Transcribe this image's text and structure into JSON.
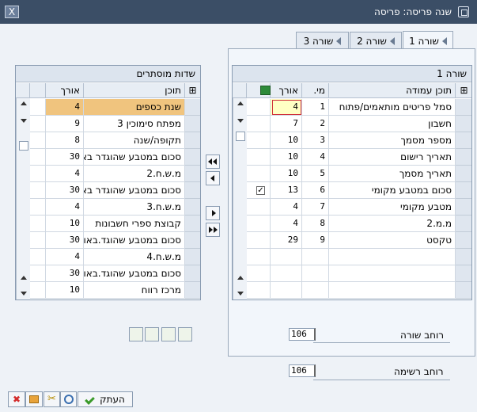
{
  "window": {
    "title": "שנה פריסה: פריסה",
    "close": "X"
  },
  "tabs": [
    {
      "label": "שורה 1",
      "active": true
    },
    {
      "label": "שורה 2",
      "active": false
    },
    {
      "label": "שורה 3",
      "active": false
    }
  ],
  "left_grid": {
    "title": "שדות מוסתרים",
    "headers": {
      "content": "תוכן",
      "length": "אורך"
    },
    "rows": [
      {
        "content": "שנת כספים",
        "length": "4",
        "highlight": true
      },
      {
        "content": "מפתח סימוכין 3",
        "length": "9"
      },
      {
        "content": "תקופה/שנה",
        "length": "8"
      },
      {
        "content": "סכום במטבע שהוגדר באו",
        "length": "30"
      },
      {
        "content": "מ.ש.ח.2",
        "length": "4"
      },
      {
        "content": "סכום במטבע שהוגדר באו",
        "length": "30"
      },
      {
        "content": "מ.ש.ח.3",
        "length": "4"
      },
      {
        "content": "קבוצת ספרי חשבונות",
        "length": "10"
      },
      {
        "content": "סכום במטבע שהוגד.באופ",
        "length": "30"
      },
      {
        "content": "מ.ש.ח.4",
        "length": "4"
      },
      {
        "content": "סכום במטבע שהוגד.באופ",
        "length": "30"
      },
      {
        "content": "מרכז רווח",
        "length": "10"
      }
    ]
  },
  "right_grid": {
    "title": "שורה 1",
    "headers": {
      "content": "תוכן עמודה",
      "number": "מי.",
      "length": "אורך"
    },
    "rows": [
      {
        "content": "סמל פריטים מותאמים/פתוח",
        "number": "1",
        "length": "4",
        "checked": false
      },
      {
        "content": "חשבון",
        "number": "2",
        "length": "7",
        "checked": false
      },
      {
        "content": "מספר מסמך",
        "number": "3",
        "length": "10",
        "checked": false
      },
      {
        "content": "תאריך רישום",
        "number": "4",
        "length": "10",
        "checked": false
      },
      {
        "content": "תאריך מסמך",
        "number": "5",
        "length": "10",
        "checked": false
      },
      {
        "content": "סכום במטבע מקומי",
        "number": "6",
        "length": "13",
        "checked": true
      },
      {
        "content": "מטבע מקומי",
        "number": "7",
        "length": "4",
        "checked": false
      },
      {
        "content": "מ.מ.2",
        "number": "8",
        "length": "4",
        "checked": false
      },
      {
        "content": "טקסט",
        "number": "9",
        "length": "29",
        "checked": false
      }
    ]
  },
  "fields": {
    "row_width_label": "רוחב שורה",
    "row_width_value": "106",
    "list_width_label": "רוחב רשימה",
    "list_width_value": "106"
  },
  "buttons": {
    "apply": "העתק"
  },
  "colors": {
    "titlebar": "#3b4e66",
    "highlight": "#f0c47e",
    "input": "#ffffc4"
  }
}
